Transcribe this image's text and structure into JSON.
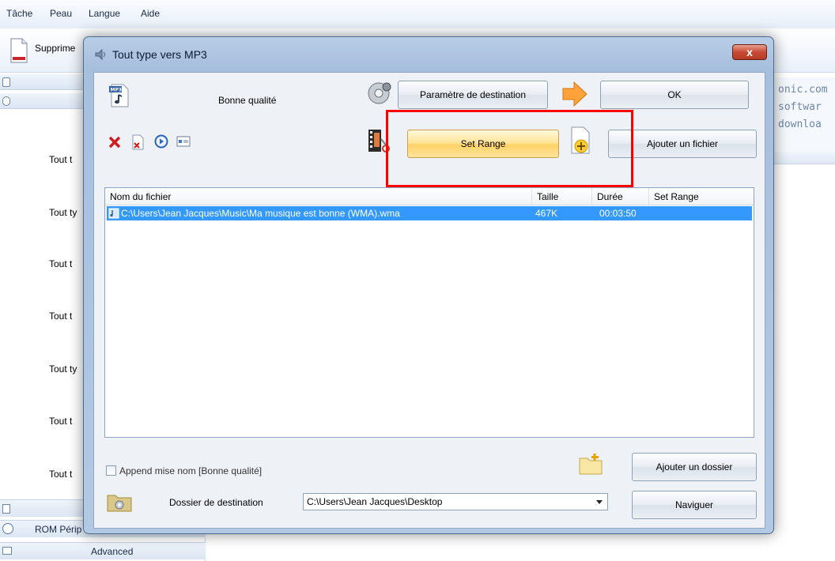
{
  "app_menu": [
    "Tâche",
    "Peau",
    "Langue",
    "Aide"
  ],
  "background": {
    "toolbar_label": "Supprime",
    "sidebar_label": "Tout t",
    "sidebar_items": [
      "Tout t",
      "Tout ty",
      "Tout t",
      "Tout t",
      "Tout ty",
      "Tout t",
      "Tout t"
    ],
    "bottom_items": [
      "ROM Périp",
      "Advanced"
    ],
    "site_lines": [
      "onic.com",
      "softwar",
      "downloa"
    ]
  },
  "dialog": {
    "title": "Tout type vers MP3",
    "close_label": "x",
    "quality_label": "Bonne qualité",
    "dest_params_button": "Paramètre de destination",
    "ok_button": "OK",
    "set_range_button": "Set Range",
    "add_file_button": "Ajouter un fichier",
    "columns": [
      "Nom du fichier",
      "Taille",
      "Durée",
      "Set Range"
    ],
    "rows": [
      {
        "file": "C:\\Users\\Jean Jacques\\Music\\Ma musique est bonne (WMA).wma",
        "size": "467K",
        "duration": "00:03:50",
        "range": ""
      }
    ],
    "append_label": "Append mise nom [Bonne qualité]",
    "add_folder_button": "Ajouter un dossier",
    "dest_folder_label": "Dossier de destination",
    "dest_folder_value": "C:\\Users\\Jean Jacques\\Desktop",
    "browse_button": "Naviguer"
  },
  "colors": {
    "selection": "#3399ff",
    "highlight_box": "#ff0000",
    "set_range_button": "#ffd268"
  }
}
